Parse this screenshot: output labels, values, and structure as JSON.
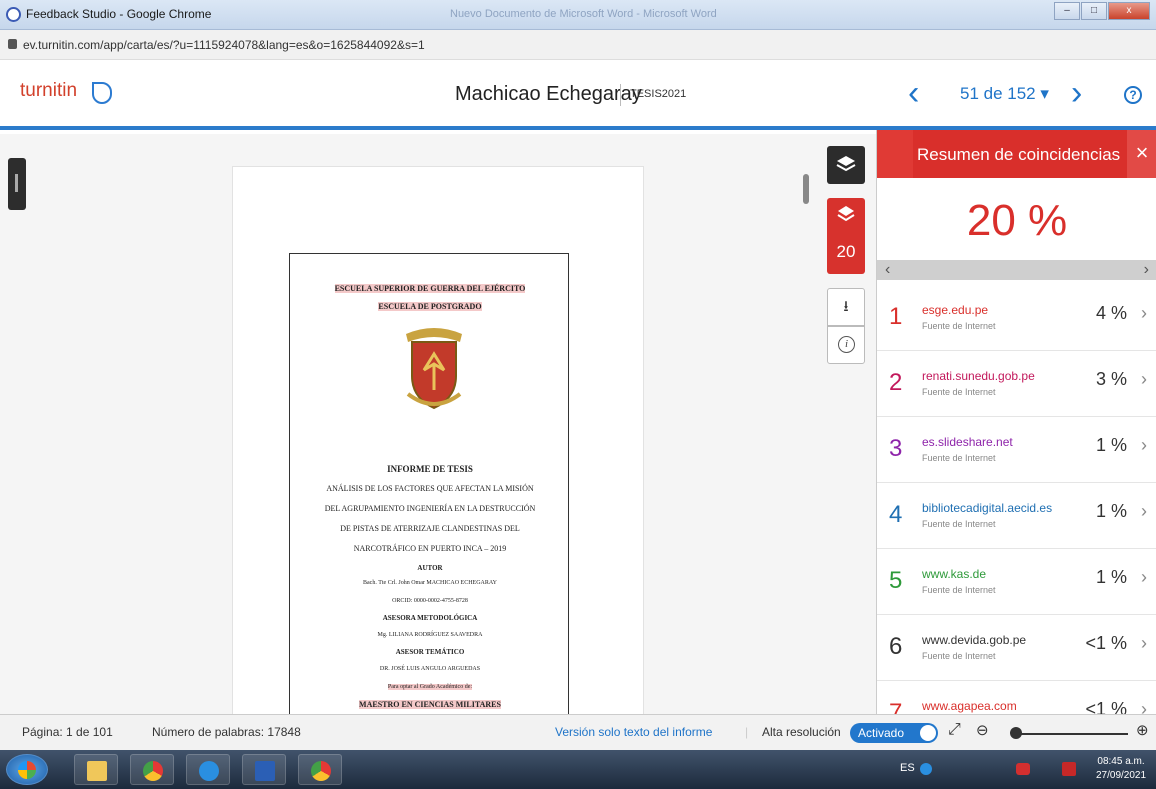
{
  "window": {
    "title": "Feedback Studio - Google Chrome",
    "ghost_title": "Nuevo Documento de Microsoft Word - Microsoft Word",
    "min_label": "–",
    "max_label": "□",
    "close_label": "x"
  },
  "browser": {
    "url": "ev.turnitin.com/app/carta/es/?u=1115924078&lang=es&o=1625844092&s=1"
  },
  "header": {
    "logo": "turnitin",
    "doc_title": "Machicao Echegaray",
    "doc_class": "TESIS2021",
    "paper_position": "51 de 152 ▾",
    "prev_icon": "‹",
    "next_icon": "›",
    "help_icon": "?"
  },
  "document": {
    "lines": [
      "ESCUELA SUPERIOR DE GUERRA DEL EJÉRCITO",
      "ESCUELA DE POSTGRADO",
      "INFORME DE TESIS",
      "ANÁLISIS DE LOS FACTORES QUE AFECTAN LA MISIÓN",
      "DEL AGRUPAMIENTO INGENIERÍA EN LA DESTRUCCIÓN",
      "DE PISTAS DE ATERRIZAJE CLANDESTINAS DEL",
      "NARCOTRÁFICO EN PUERTO INCA – 2019",
      "AUTOR",
      "Bach. Tte Crl. John Omar MACHICAO ECHEGARAY",
      "ORCID: 0000-0002-4755-8728",
      "ASESORA METODOLÓGICA",
      "Mg. LILIANA RODRÍGUEZ SAAVEDRA",
      "ASESOR TEMÁTICO",
      "DR. JOSÉ LUIS ANGULO ARGUEDAS",
      "Para optar al Grado Académico de:",
      "MAESTRO EN CIENCIAS MILITARES"
    ]
  },
  "tools": {
    "match_count": "20",
    "download_icon": "⭳",
    "info_icon": "i"
  },
  "panel": {
    "title": "Resumen de coincidencias",
    "close_icon": "×",
    "total": "20 %",
    "scroll_left": "‹",
    "scroll_right": "›",
    "matches": [
      {
        "num": "1",
        "source": "esge.edu.pe",
        "type": "Fuente de Internet",
        "pct": "4 %",
        "color": "#d92f2b"
      },
      {
        "num": "2",
        "source": "renati.sunedu.gob.pe",
        "type": "Fuente de Internet",
        "pct": "3 %",
        "color": "#c2185b"
      },
      {
        "num": "3",
        "source": "es.slideshare.net",
        "type": "Fuente de Internet",
        "pct": "1 %",
        "color": "#8e24aa"
      },
      {
        "num": "4",
        "source": "bibliotecadigital.aecid.es",
        "type": "Fuente de Internet",
        "pct": "1 %",
        "color": "#1f6fb2"
      },
      {
        "num": "5",
        "source": "www.kas.de",
        "type": "Fuente de Internet",
        "pct": "1 %",
        "color": "#2e9a3a"
      },
      {
        "num": "6",
        "source": "www.devida.gob.pe",
        "type": "Fuente de Internet",
        "pct": "<1 %",
        "color": "#333333"
      },
      {
        "num": "7",
        "source": "www.agapea.com",
        "type": "",
        "pct": "<1 %",
        "color": "#d92f2b"
      }
    ]
  },
  "footer": {
    "page": "Página: 1 de 101",
    "words": "Número de palabras: 17848",
    "text_only": "Versión solo texto del informe",
    "hires": "Alta resolución",
    "toggle": "Activado",
    "expand_icon": "⤢",
    "zoom_out_icon": "⊖",
    "zoom_in_icon": "⊕"
  },
  "taskbar": {
    "lang": "ES",
    "time": "08:45 a.m.",
    "date": "27/09/2021"
  }
}
